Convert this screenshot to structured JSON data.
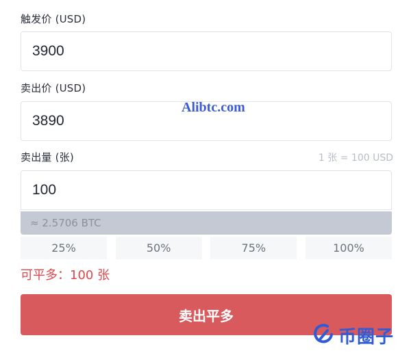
{
  "trigger": {
    "label": "触发价 (USD)",
    "value": "3900"
  },
  "sell_price": {
    "label": "卖出价 (USD)",
    "value": "3890"
  },
  "amount": {
    "label": "卖出量 (张)",
    "unit_hint": "1 张 = 100 USD",
    "value": "100",
    "converted": "≈ 2.5706 BTC"
  },
  "percentages": [
    "25%",
    "50%",
    "75%",
    "100%"
  ],
  "available": "可平多：100 张",
  "action_button": "卖出平多",
  "watermark": "Alibtc.com",
  "logo": {
    "text": "币圈子",
    "icon": "coin-logo-icon",
    "color": "#2f5bd6"
  },
  "colors": {
    "accent_red": "#d95a5c",
    "warning_text": "#e0464a"
  }
}
